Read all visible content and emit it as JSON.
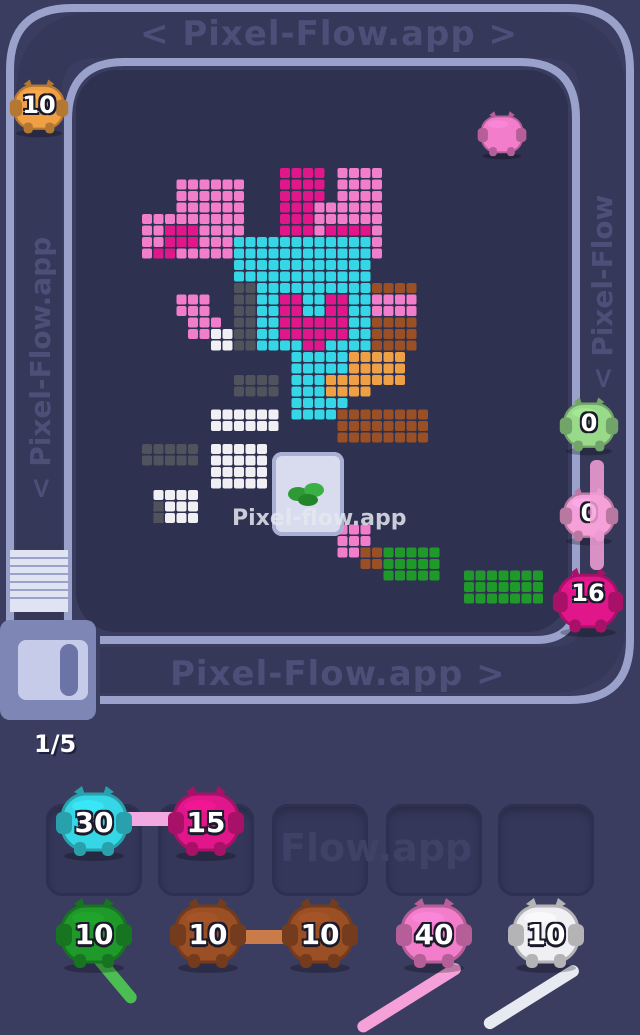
{
  "watermarks": {
    "top": "< Pixel-Flow.app >",
    "bottom": "Pixel-Flow.app >",
    "left": "< Pixel-Flow.app",
    "right": "< Pixel-Flow",
    "slots": "Flow.app",
    "center": "Pixel-flow.app"
  },
  "level_counter": "1/5",
  "colors": {
    "cyan": "#35d6e6",
    "magenta": "#e0168a",
    "green": "#1f9a2a",
    "brown": "#9a4f25",
    "pink": "#f27dcb",
    "white": "#f0f0f4",
    "orange": "#f0a044",
    "light_green": "#98d98a",
    "light_pink": "#f5a0d8",
    "gray": "#8a8c96",
    "dark_gray": "#50525c"
  },
  "conveyor_shooters": [
    {
      "id": "orange",
      "label": "10",
      "color_key": "orange"
    },
    {
      "id": "light-green",
      "label": "0",
      "color_key": "light_green"
    },
    {
      "id": "light-pink",
      "label": "0",
      "color_key": "light_pink"
    },
    {
      "id": "magenta",
      "label": "16",
      "color_key": "magenta"
    },
    {
      "id": "pink-small",
      "label": "",
      "color_key": "pink"
    }
  ],
  "queue_row": [
    {
      "id": "cyan",
      "label": "30",
      "color_key": "cyan"
    },
    {
      "id": "magenta",
      "label": "15",
      "color_key": "magenta"
    }
  ],
  "bottom_row": [
    {
      "id": "green",
      "label": "10",
      "color_key": "green"
    },
    {
      "id": "brown-1",
      "label": "10",
      "color_key": "brown"
    },
    {
      "id": "brown-2",
      "label": "10",
      "color_key": "brown"
    },
    {
      "id": "pink",
      "label": "40",
      "color_key": "pink"
    },
    {
      "id": "white",
      "label": "10",
      "color_key": "white"
    }
  ],
  "slots_count": 5
}
